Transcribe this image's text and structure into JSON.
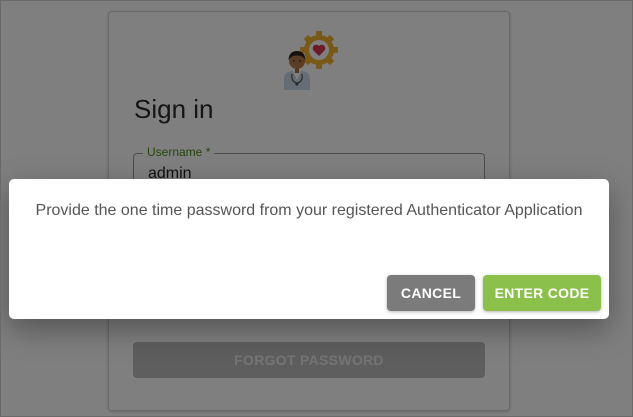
{
  "login": {
    "title": "Sign in",
    "username_label": "Username *",
    "username_value": "admin",
    "forgot_label": "FORGOT PASSWORD"
  },
  "dialog": {
    "message": "Provide the one time password from your registered Authenticator Application",
    "cancel_label": "CANCEL",
    "enter_label": "ENTER CODE"
  },
  "icons": {
    "logo": "doctor-heart-gear-icon"
  },
  "colors": {
    "accent_green": "#8bc04a",
    "label_green": "#4e8a1c",
    "cancel_gray": "#7b7b7b",
    "forgot_gray": "#bdbdbd",
    "overlay": "rgba(0,0,0,0.5)"
  }
}
